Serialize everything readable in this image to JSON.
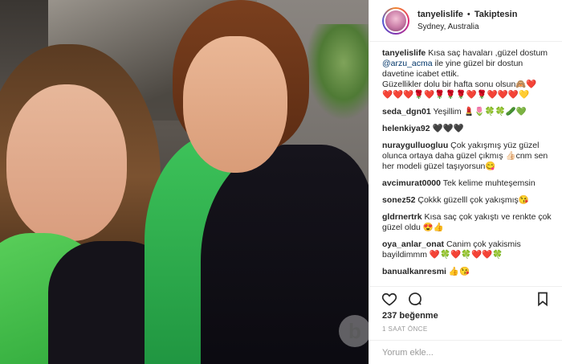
{
  "post": {
    "username": "tanyelislife",
    "separator": "•",
    "follow_status": "Takiptesin",
    "location": "Sydney, Australia",
    "likes_label": "237 beğenme",
    "timestamp": "1 SAAT ÖNCE",
    "comment_placeholder": "Yorum ekle..."
  },
  "caption": {
    "user": "tanyelislife",
    "text_1": "Kısa saç havaları ,güzel dostum",
    "mention": "@arzu_acma",
    "text_2": "ile yine güzel bir dostun davetine icabet ettik.",
    "text_3": "Güzellikler dolu bir hafta sonu olsun🙈❤️",
    "emojis": "❤️❤️❤️🌹❤️🌹🌹🌹❤️🌹❤️❤️❤️💛"
  },
  "comments": [
    {
      "user": "seda_dgn01",
      "text": "Yeşillim 💄🌷🍀🍀🥒💚"
    },
    {
      "user": "helenkiya92",
      "text": "🖤🖤🖤"
    },
    {
      "user": "nuraygulluogluu",
      "text": "Çok yakışmış yüz güzel olunca ortaya daha güzel çıkmış 👍🏻cnm sen her modeli güzel taşıyorsun😋"
    },
    {
      "user": "avcimurat0000",
      "text": "Tek kelime muhteşemsin"
    },
    {
      "user": "sonez52",
      "text": "Çokkk güzelll çok yakışmış😘"
    },
    {
      "user": "gldrnertrk",
      "text": "Kısa saç çok yakıştı ve renkte çok güzel oldu 😍👍"
    },
    {
      "user": "oya_anlar_onat",
      "text": "Canim çok yakismis bayildimmm ❤️🍀❤️🍀❤️❤️🍀"
    },
    {
      "user": "banualkanresmi",
      "text": "👍😘"
    }
  ],
  "icons": {
    "heart": "heart-icon",
    "comment": "comment-icon",
    "bookmark": "bookmark-icon",
    "watermark": "watermark-logo"
  },
  "watermark_letter": "b",
  "colors": {
    "mention": "#003569",
    "meta": "#999999",
    "text": "#262626"
  }
}
